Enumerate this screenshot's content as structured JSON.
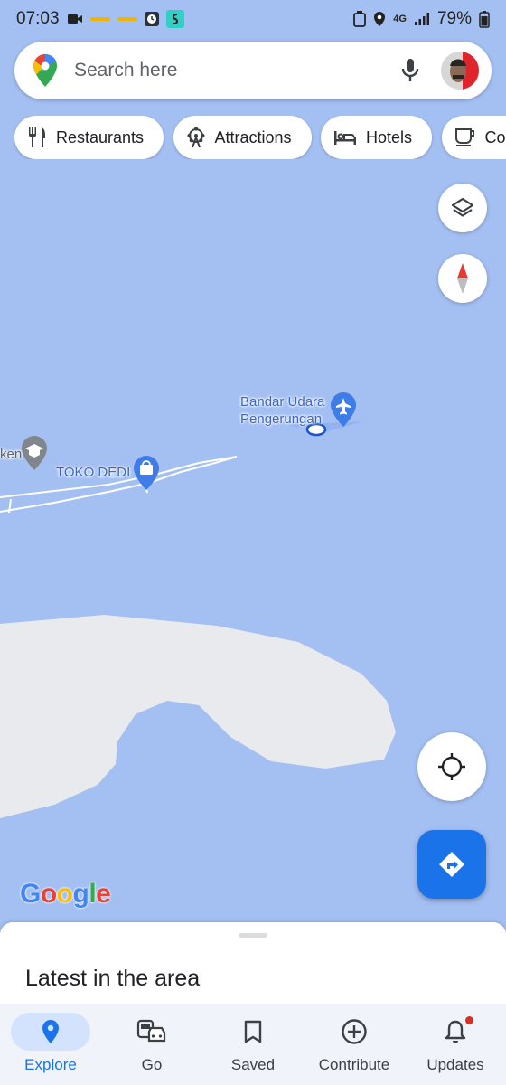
{
  "status_bar": {
    "time": "07:03",
    "network": "4G",
    "battery": "79%"
  },
  "search": {
    "placeholder": "Search here",
    "icons": [
      "maps-pin-icon",
      "mic-icon",
      "avatar"
    ]
  },
  "chips": [
    {
      "label": "Restaurants",
      "icon": "fork-knife-icon"
    },
    {
      "label": "Attractions",
      "icon": "ferris-wheel-icon"
    },
    {
      "label": "Hotels",
      "icon": "bed-icon"
    },
    {
      "label": "Co",
      "icon": "coffee-icon"
    }
  ],
  "map": {
    "labels": {
      "airport": "Bandar Udara Pengerungan",
      "shop": "TOKO DEDI",
      "partial_place": "ken"
    },
    "colors": {
      "water": "#a4bff2",
      "land": "#e8eaed",
      "label_blue": "#3b66c4",
      "accent": "#1a73e8"
    }
  },
  "controls": {
    "layers": "layers-icon",
    "compass": "compass-icon",
    "locate": "my-location-icon",
    "directions": "directions-icon"
  },
  "sheet": {
    "title": "Latest in the area"
  },
  "nav": [
    {
      "label": "Explore",
      "icon": "explore-pin-icon",
      "active": true
    },
    {
      "label": "Go",
      "icon": "commute-icon",
      "active": false
    },
    {
      "label": "Saved",
      "icon": "bookmark-icon",
      "active": false
    },
    {
      "label": "Contribute",
      "icon": "add-circle-icon",
      "active": false
    },
    {
      "label": "Updates",
      "icon": "bell-icon",
      "active": false
    }
  ]
}
